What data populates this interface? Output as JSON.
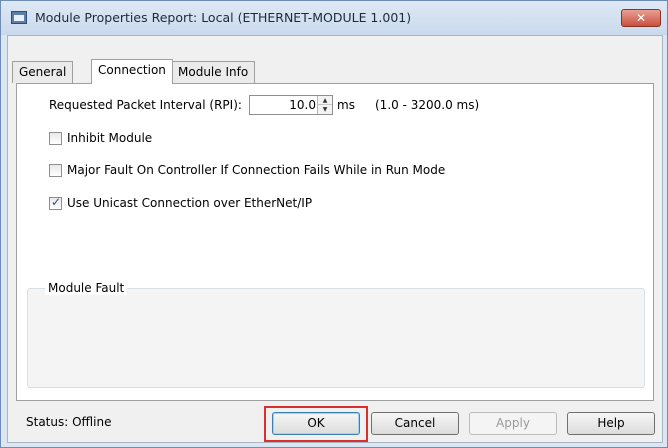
{
  "window": {
    "title": "Module Properties Report: Local (ETHERNET-MODULE 1.001)",
    "close_glyph": "✕"
  },
  "tabs": [
    {
      "label": "General",
      "active": false
    },
    {
      "label": "Connection",
      "active": true
    },
    {
      "label": "Module Info",
      "active": false
    }
  ],
  "rpi": {
    "label": "Requested Packet Interval (RPI):",
    "value": "10.0",
    "unit": "ms",
    "range": "(1.0 - 3200.0 ms)"
  },
  "options": [
    {
      "label": "Inhibit Module",
      "checked": false
    },
    {
      "label": "Major Fault On Controller If Connection Fails While in Run Mode",
      "checked": false
    },
    {
      "label": "Use Unicast Connection over EtherNet/IP",
      "checked": true
    }
  ],
  "module_fault": {
    "label": "Module Fault"
  },
  "status": {
    "text": "Status:  Offline"
  },
  "buttons": {
    "ok": "OK",
    "cancel": "Cancel",
    "apply": "Apply",
    "help": "Help"
  },
  "checkmark_glyph": "✓",
  "colors": {
    "highlight": "#d9302e",
    "close": "#c8513f"
  }
}
